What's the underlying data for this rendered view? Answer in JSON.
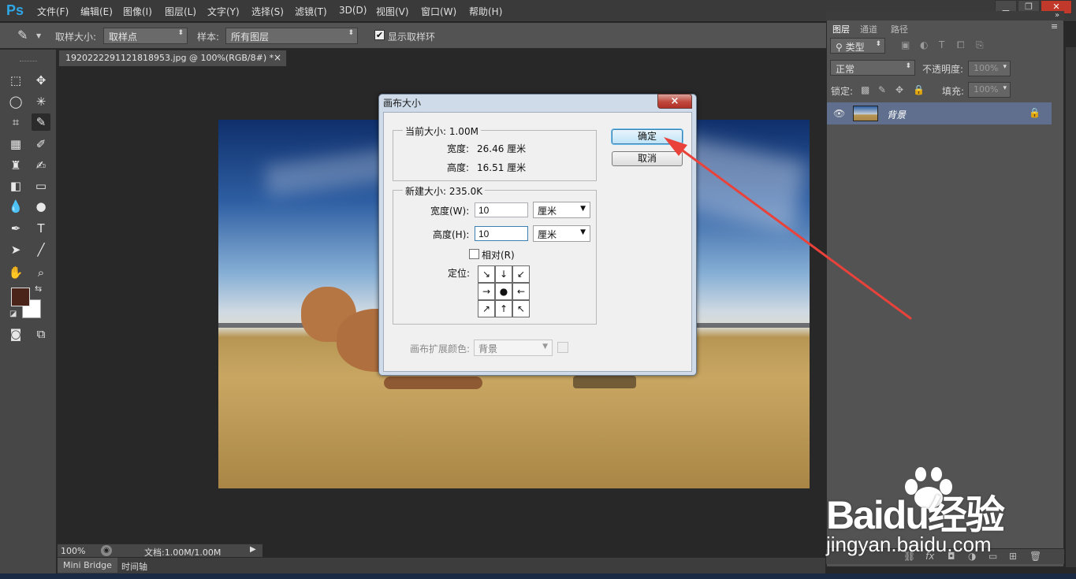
{
  "app": {
    "logo": "Ps"
  },
  "menu": [
    "文件(F)",
    "编辑(E)",
    "图像(I)",
    "图层(L)",
    "文字(Y)",
    "选择(S)",
    "滤镜(T)",
    "3D(D)",
    "视图(V)",
    "窗口(W)",
    "帮助(H)"
  ],
  "options_bar": {
    "sample_size_label": "取样大小:",
    "sample_size_value": "取样点",
    "sample_label": "样本:",
    "sample_value": "所有图层",
    "show_ring_label": "显示取样环",
    "show_ring_checked": true
  },
  "document": {
    "tab_title": "1920222291121818953.jpg @ 100%(RGB/8#) *",
    "tab_close": "×",
    "zoom": "100%",
    "doc_info": "文档:1.00M/1.00M"
  },
  "bottom_tabs": [
    "Mini Bridge",
    "时间轴"
  ],
  "layers_panel": {
    "tabs": [
      "图层",
      "通道",
      "路径"
    ],
    "filter_kind": "类型",
    "blend_mode": "正常",
    "opacity_label": "不透明度:",
    "opacity_value": "100%",
    "lock_label": "锁定:",
    "fill_label": "填充:",
    "fill_value": "100%",
    "layer_name": "背景"
  },
  "dialog": {
    "title": "画布大小",
    "close": "×",
    "current_size": "当前大小: 1.00M",
    "current_width_label": "宽度:",
    "current_width_value": "26.46 厘米",
    "current_height_label": "高度:",
    "current_height_value": "16.51 厘米",
    "new_size": "新建大小: 235.0K",
    "width_label": "宽度(W):",
    "width_value": "10",
    "width_unit": "厘米",
    "height_label": "高度(H):",
    "height_value": "10",
    "height_unit": "厘米",
    "relative_label": "相对(R)",
    "relative_checked": false,
    "anchor_label": "定位:",
    "anchor_glyphs": [
      "↘",
      "↓",
      "↙",
      "→",
      "●",
      "←",
      "↗",
      "↑",
      "↖"
    ],
    "extension_color_label": "画布扩展颜色:",
    "extension_color_value": "背景",
    "ok": "确定",
    "cancel": "取消"
  },
  "watermark": {
    "brand": "Baidu经验",
    "url": "jingyan.baidu.com"
  },
  "colors": {
    "accent_arrow": "#e8423b",
    "ps_blue": "#2fa6e5",
    "foreground": "#4a2418",
    "background": "#ffffff"
  }
}
